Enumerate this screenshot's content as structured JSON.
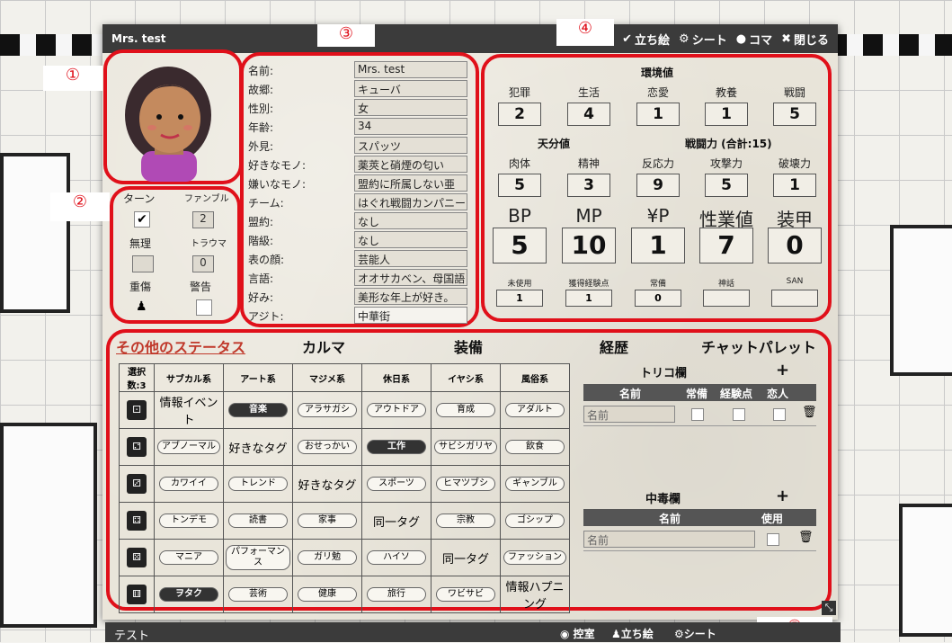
{
  "window": {
    "title": "Mrs. test",
    "toolbar": [
      "立ち絵",
      "シート",
      "コマ",
      "閉じる"
    ]
  },
  "markers": [
    "①",
    "②",
    "③",
    "④",
    "⑤"
  ],
  "flags": {
    "turn_label": "ターン",
    "fumble_label": "ファンブル",
    "fumble_value": "2",
    "impossible_label": "無理",
    "trauma_label": "トラウマ",
    "trauma_value": "0",
    "heavy_wound_label": "重傷",
    "warning_label": "警告"
  },
  "profile": [
    {
      "label": "名前:",
      "value": "Mrs. test"
    },
    {
      "label": "故郷:",
      "value": "キューバ"
    },
    {
      "label": "性別:",
      "value": "女"
    },
    {
      "label": "年齢:",
      "value": "34"
    },
    {
      "label": "外見:",
      "value": "スパッツ"
    },
    {
      "label": "好きなモノ:",
      "value": "薬莢と硝煙の匂い"
    },
    {
      "label": "嫌いなモノ:",
      "value": "盟約に所属しない亜"
    },
    {
      "label": "チーム:",
      "value": "はぐれ戦闘カンパニー"
    },
    {
      "label": "盟約:",
      "value": "なし"
    },
    {
      "label": "階級:",
      "value": "なし"
    },
    {
      "label": "表の顔:",
      "value": "芸能人"
    },
    {
      "label": "言語:",
      "value": "オオサカベン、母国語"
    },
    {
      "label": "好み:",
      "value": "美形な年上が好き。"
    },
    {
      "label": "アジト:",
      "value": "中華街"
    }
  ],
  "stats": {
    "env_title": "環境値",
    "env": [
      {
        "label": "犯罪",
        "value": "2"
      },
      {
        "label": "生活",
        "value": "4"
      },
      {
        "label": "恋愛",
        "value": "1"
      },
      {
        "label": "教養",
        "value": "1"
      },
      {
        "label": "戦闘",
        "value": "5"
      }
    ],
    "talent_title": "天分値",
    "combat_title": "戦闘力 (合計:15)",
    "talent": [
      {
        "label": "肉体",
        "value": "5"
      },
      {
        "label": "精神",
        "value": "3"
      },
      {
        "label": "反応力",
        "value": "9"
      },
      {
        "label": "攻撃力",
        "value": "5"
      },
      {
        "label": "破壊力",
        "value": "1"
      }
    ],
    "big": [
      {
        "label": "BP",
        "value": "5"
      },
      {
        "label": "MP",
        "value": "10"
      },
      {
        "label": "¥P",
        "value": "1"
      },
      {
        "label": "性業値",
        "value": "7"
      },
      {
        "label": "装甲",
        "value": "0"
      }
    ],
    "small": [
      {
        "label": "未使用",
        "value": "1"
      },
      {
        "label": "獲得経験点",
        "value": "1"
      },
      {
        "label": "常備",
        "value": "0"
      },
      {
        "label": "神話",
        "value": ""
      },
      {
        "label": "SAN",
        "value": ""
      }
    ]
  },
  "tabs": [
    "その他のステータス",
    "カルマ",
    "装備",
    "経歴",
    "チャットパレット"
  ],
  "grid": {
    "headers": [
      "選択数:3",
      "サブカル系",
      "アート系",
      "マジメ系",
      "休日系",
      "イヤシ系",
      "風俗系"
    ],
    "rows": [
      {
        "die": "⚀",
        "cells": [
          {
            "t": "text",
            "v": "情報イベント"
          },
          {
            "t": "on",
            "v": "音楽"
          },
          {
            "t": "pill",
            "v": "アラサガシ"
          },
          {
            "t": "pill",
            "v": "アウトドア"
          },
          {
            "t": "pill",
            "v": "育成"
          },
          {
            "t": "pill",
            "v": "アダルト"
          }
        ]
      },
      {
        "die": "⚁",
        "cells": [
          {
            "t": "pill",
            "v": "アブノーマル"
          },
          {
            "t": "text",
            "v": "好きなタグ"
          },
          {
            "t": "pill",
            "v": "おせっかい"
          },
          {
            "t": "on",
            "v": "工作"
          },
          {
            "t": "pill",
            "v": "サビシガリヤ"
          },
          {
            "t": "pill",
            "v": "飲食"
          }
        ]
      },
      {
        "die": "⚂",
        "cells": [
          {
            "t": "pill",
            "v": "カワイイ"
          },
          {
            "t": "pill",
            "v": "トレンド"
          },
          {
            "t": "text",
            "v": "好きなタグ"
          },
          {
            "t": "pill",
            "v": "スポーツ"
          },
          {
            "t": "pill",
            "v": "ヒマツブシ"
          },
          {
            "t": "pill",
            "v": "ギャンブル"
          }
        ]
      },
      {
        "die": "⚃",
        "cells": [
          {
            "t": "pill",
            "v": "トンデモ"
          },
          {
            "t": "pill",
            "v": "読書"
          },
          {
            "t": "pill",
            "v": "家事"
          },
          {
            "t": "text",
            "v": "同一タグ"
          },
          {
            "t": "pill",
            "v": "宗教"
          },
          {
            "t": "pill",
            "v": "ゴシップ"
          }
        ]
      },
      {
        "die": "⚄",
        "cells": [
          {
            "t": "pill",
            "v": "マニア"
          },
          {
            "t": "pill",
            "v": "パフォーマンス"
          },
          {
            "t": "pill",
            "v": "ガリ勉"
          },
          {
            "t": "pill",
            "v": "ハイソ"
          },
          {
            "t": "text",
            "v": "同一タグ"
          },
          {
            "t": "pill",
            "v": "ファッション"
          }
        ]
      },
      {
        "die": "⚅",
        "cells": [
          {
            "t": "on",
            "v": "ヲタク"
          },
          {
            "t": "pill",
            "v": "芸術"
          },
          {
            "t": "pill",
            "v": "健康"
          },
          {
            "t": "pill",
            "v": "旅行"
          },
          {
            "t": "pill",
            "v": "ワビサビ"
          },
          {
            "t": "text",
            "v": "情報ハプニング"
          }
        ]
      }
    ]
  },
  "trico": {
    "title": "トリコ欄",
    "cols": [
      "名前",
      "常備",
      "経験点",
      "恋人"
    ],
    "name_placeholder": "名前"
  },
  "poison": {
    "title": "中毒欄",
    "cols": [
      "名前",
      "使用"
    ],
    "name_placeholder": "名前"
  },
  "footer": {
    "title": "テスト",
    "toolbar": [
      "控室",
      "立ち絵",
      "シート"
    ]
  }
}
